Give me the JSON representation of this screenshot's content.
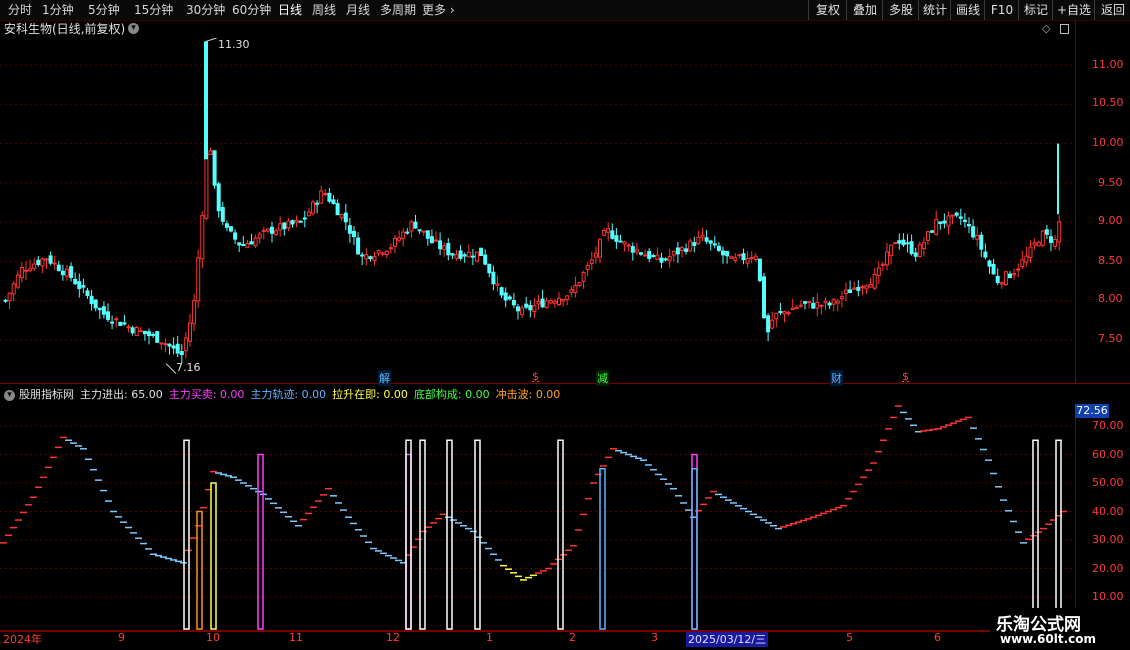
{
  "toolbar": {
    "periods": [
      "分时",
      "1分钟",
      "5分钟",
      "15分钟",
      "30分钟",
      "60分钟",
      "日线",
      "周线",
      "月线",
      "多周期",
      "更多"
    ],
    "active_period": "日线",
    "right_buttons": [
      "复权",
      "叠加",
      "多股",
      "统计",
      "画线",
      "F10",
      "标记",
      "+自选",
      "返回"
    ]
  },
  "header": {
    "title": "安科生物(日线,前复权)",
    "diamond_icon": "diamond-icon",
    "panel_icon": "panel-toggle-icon"
  },
  "price_axis": {
    "ticks": [
      "11.00",
      "10.50",
      "10.00",
      "9.50",
      "9.00",
      "8.50",
      "8.00",
      "7.50"
    ],
    "high_label": "11.30",
    "low_label": "7.16"
  },
  "markers": [
    {
      "text": "解",
      "color": "#5fb4ff"
    },
    {
      "text": "$",
      "color": "#ff4040"
    },
    {
      "text": "减",
      "color": "#40ff40"
    },
    {
      "text": "财",
      "color": "#5fb4ff"
    },
    {
      "text": "$",
      "color": "#ff4040"
    }
  ],
  "indicator": {
    "name": "股朋指标网",
    "items": [
      {
        "label": "主力进出:",
        "value": "65.00",
        "color": "#e0e0e0"
      },
      {
        "label": "主力买卖:",
        "value": "0.00",
        "color": "#ff40ff"
      },
      {
        "label": "主力轨迹:",
        "value": "0.00",
        "color": "#5fb4ff"
      },
      {
        "label": "拉升在即:",
        "value": "0.00",
        "color": "#ffff40"
      },
      {
        "label": "底部构成:",
        "value": "0.00",
        "color": "#40ff40"
      },
      {
        "label": "冲击波:",
        "value": "0.00",
        "color": "#ffa020"
      }
    ],
    "current_value": "72.56",
    "axis_ticks": [
      "70.00",
      "60.00",
      "50.00",
      "40.00",
      "30.00",
      "20.00",
      "10.00"
    ]
  },
  "date_axis": {
    "labels": [
      "2024年",
      "9",
      "10",
      "11",
      "12",
      "1",
      "2",
      "3",
      "2025/03/12/三",
      "5",
      "6"
    ]
  },
  "watermark": {
    "title": "乐淘公式网",
    "url": "www.60lt.com"
  },
  "colors": {
    "up": "#ff3333",
    "down": "#54ffff",
    "grid": "#5a0000",
    "accent": "#ff3b3b"
  }
}
